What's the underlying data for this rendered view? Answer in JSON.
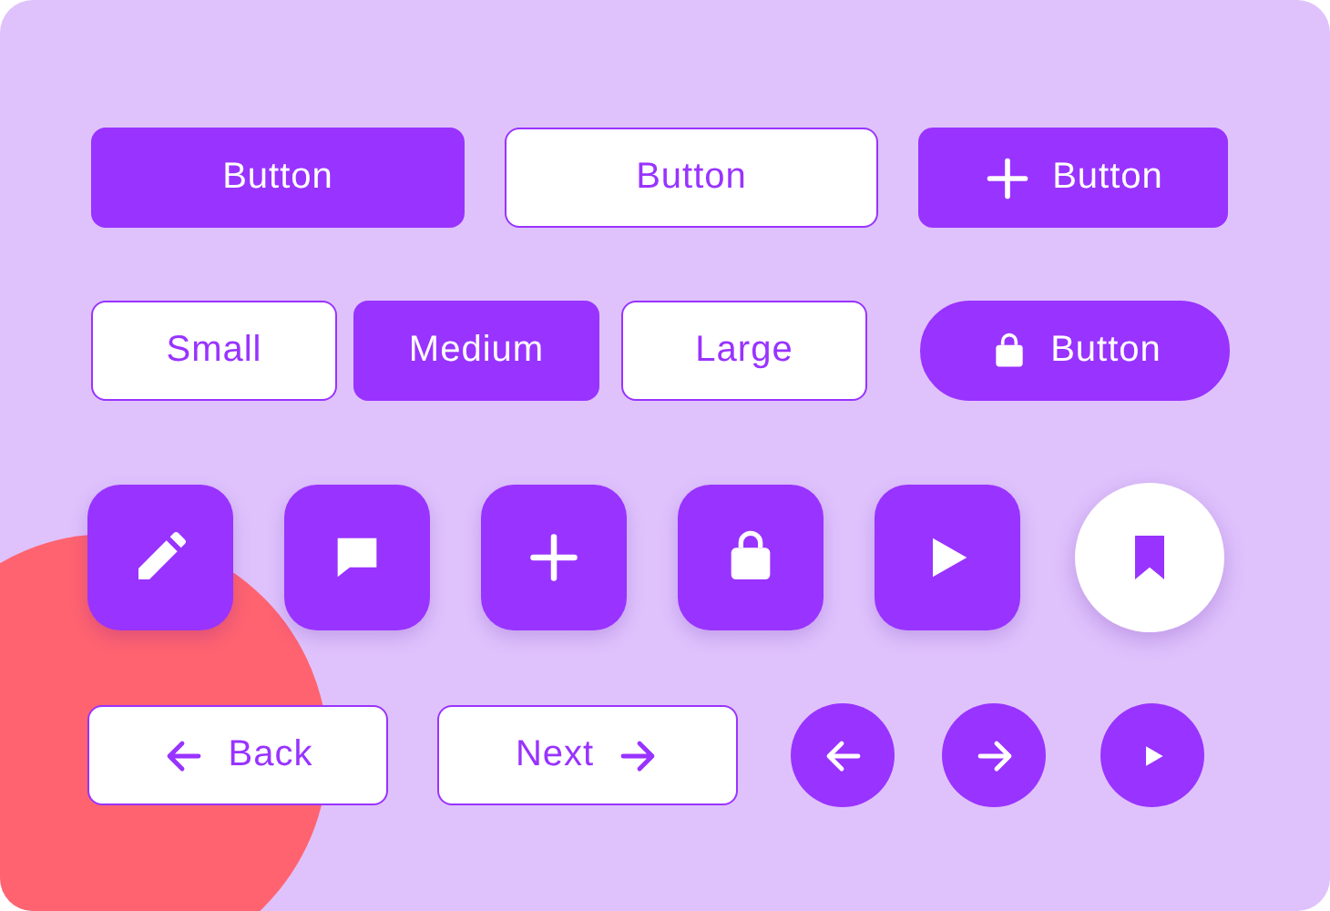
{
  "buttons": [
    {
      "kind": "filled",
      "label": "Button"
    },
    {
      "kind": "outline",
      "label": "Button"
    },
    {
      "kind": "filled",
      "label": "Button"
    }
  ],
  "sizes": [
    {
      "label": "Small",
      "selected": false
    },
    {
      "label": "Medium",
      "selected": true
    },
    {
      "label": "Large",
      "selected": false
    }
  ],
  "pill": {
    "label": "Button"
  },
  "nav": [
    {
      "label": "Back"
    },
    {
      "label": "Next"
    }
  ]
}
